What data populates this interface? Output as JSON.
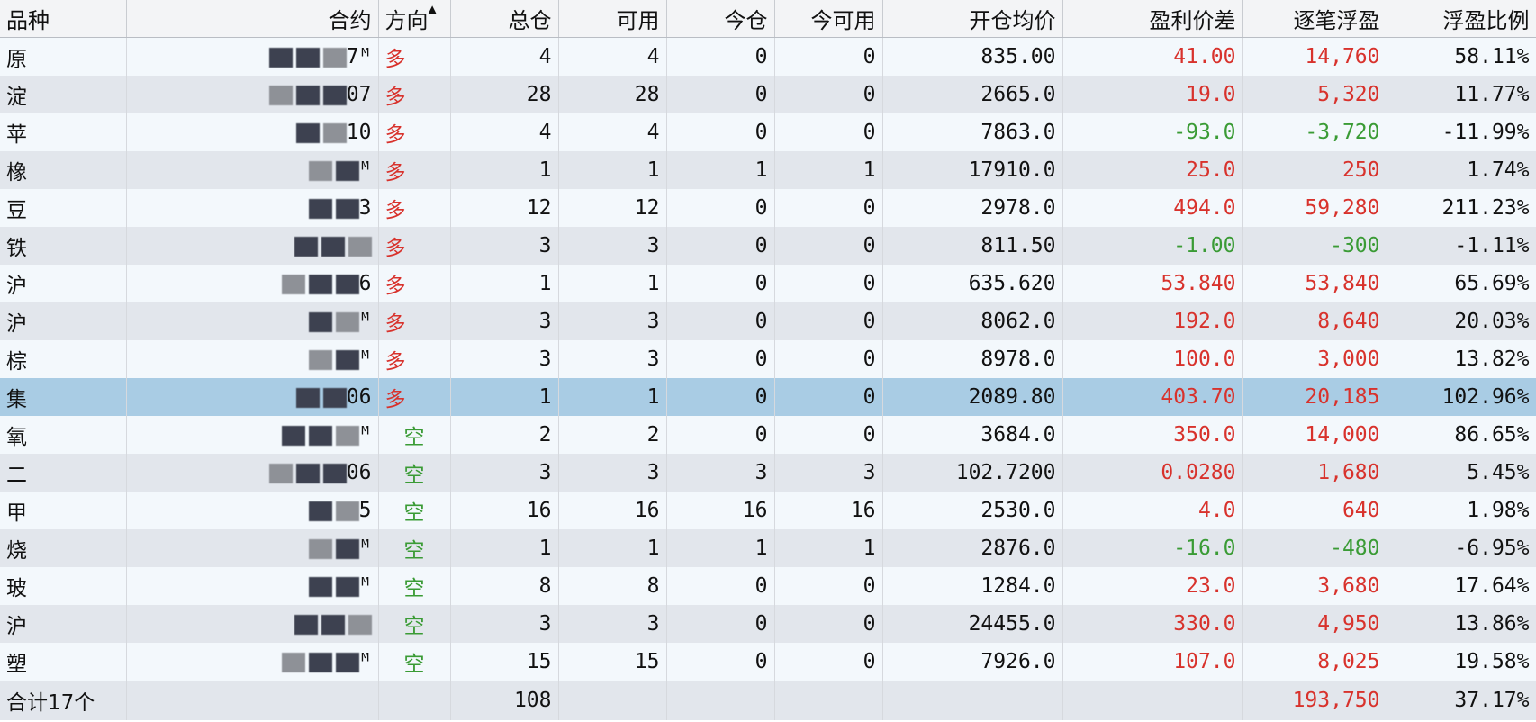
{
  "headers": {
    "variety": "品种",
    "contract": "合约",
    "direction": "方向",
    "total": "总仓",
    "available": "可用",
    "today": "今仓",
    "today_available": "今可用",
    "avg_price": "开仓均价",
    "profit_diff": "盈利价差",
    "float_pl": "逐笔浮盈",
    "float_ratio": "浮盈比例"
  },
  "sort_indicator": "▲",
  "rows": [
    {
      "variety": "原",
      "contract": "7ᴹ",
      "direction": "多",
      "dir_type": "long",
      "total": "4",
      "avail": "4",
      "today": "0",
      "today_avail": "0",
      "avg": "835.00",
      "diff": "41.00",
      "pl": "14,760",
      "ratio": "58.11%",
      "sign": "pos"
    },
    {
      "variety": "淀",
      "contract": "07",
      "direction": "多",
      "dir_type": "long",
      "total": "28",
      "avail": "28",
      "today": "0",
      "today_avail": "0",
      "avg": "2665.0",
      "diff": "19.0",
      "pl": "5,320",
      "ratio": "11.77%",
      "sign": "pos"
    },
    {
      "variety": "苹",
      "contract": "10",
      "direction": "多",
      "dir_type": "long",
      "total": "4",
      "avail": "4",
      "today": "0",
      "today_avail": "0",
      "avg": "7863.0",
      "diff": "-93.0",
      "pl": "-3,720",
      "ratio": "-11.99%",
      "sign": "neg"
    },
    {
      "variety": "橡",
      "contract": "ᴹ",
      "direction": "多",
      "dir_type": "long",
      "total": "1",
      "avail": "1",
      "today": "1",
      "today_avail": "1",
      "avg": "17910.0",
      "diff": "25.0",
      "pl": "250",
      "ratio": "1.74%",
      "sign": "pos"
    },
    {
      "variety": "豆",
      "contract": "3",
      "direction": "多",
      "dir_type": "long",
      "total": "12",
      "avail": "12",
      "today": "0",
      "today_avail": "0",
      "avg": "2978.0",
      "diff": "494.0",
      "pl": "59,280",
      "ratio": "211.23%",
      "sign": "pos"
    },
    {
      "variety": "铁",
      "contract": "",
      "direction": "多",
      "dir_type": "long",
      "total": "3",
      "avail": "3",
      "today": "0",
      "today_avail": "0",
      "avg": "811.50",
      "diff": "-1.00",
      "pl": "-300",
      "ratio": "-1.11%",
      "sign": "neg"
    },
    {
      "variety": "沪",
      "contract": "6",
      "direction": "多",
      "dir_type": "long",
      "total": "1",
      "avail": "1",
      "today": "0",
      "today_avail": "0",
      "avg": "635.620",
      "diff": "53.840",
      "pl": "53,840",
      "ratio": "65.69%",
      "sign": "pos"
    },
    {
      "variety": "沪",
      "contract": "ᴹ",
      "direction": "多",
      "dir_type": "long",
      "total": "3",
      "avail": "3",
      "today": "0",
      "today_avail": "0",
      "avg": "8062.0",
      "diff": "192.0",
      "pl": "8,640",
      "ratio": "20.03%",
      "sign": "pos"
    },
    {
      "variety": "棕",
      "contract": "ᴹ",
      "direction": "多",
      "dir_type": "long",
      "total": "3",
      "avail": "3",
      "today": "0",
      "today_avail": "0",
      "avg": "8978.0",
      "diff": "100.0",
      "pl": "3,000",
      "ratio": "13.82%",
      "sign": "pos"
    },
    {
      "variety": "集",
      "contract": "06",
      "direction": "多",
      "dir_type": "long",
      "total": "1",
      "avail": "1",
      "today": "0",
      "today_avail": "0",
      "avg": "2089.80",
      "diff": "403.70",
      "pl": "20,185",
      "ratio": "102.96%",
      "sign": "pos",
      "selected": true
    },
    {
      "variety": "氧",
      "contract": "ᴹ",
      "direction": "空",
      "dir_type": "short",
      "total": "2",
      "avail": "2",
      "today": "0",
      "today_avail": "0",
      "avg": "3684.0",
      "diff": "350.0",
      "pl": "14,000",
      "ratio": "86.65%",
      "sign": "pos"
    },
    {
      "variety": "二",
      "contract": "06",
      "direction": "空",
      "dir_type": "short",
      "total": "3",
      "avail": "3",
      "today": "3",
      "today_avail": "3",
      "avg": "102.7200",
      "diff": "0.0280",
      "pl": "1,680",
      "ratio": "5.45%",
      "sign": "pos"
    },
    {
      "variety": "甲",
      "contract": "5",
      "direction": "空",
      "dir_type": "short",
      "total": "16",
      "avail": "16",
      "today": "16",
      "today_avail": "16",
      "avg": "2530.0",
      "diff": "4.0",
      "pl": "640",
      "ratio": "1.98%",
      "sign": "pos"
    },
    {
      "variety": "烧",
      "contract": "ᴹ",
      "direction": "空",
      "dir_type": "short",
      "total": "1",
      "avail": "1",
      "today": "1",
      "today_avail": "1",
      "avg": "2876.0",
      "diff": "-16.0",
      "pl": "-480",
      "ratio": "-6.95%",
      "sign": "neg"
    },
    {
      "variety": "玻",
      "contract": "ᴹ",
      "direction": "空",
      "dir_type": "short",
      "total": "8",
      "avail": "8",
      "today": "0",
      "today_avail": "0",
      "avg": "1284.0",
      "diff": "23.0",
      "pl": "3,680",
      "ratio": "17.64%",
      "sign": "pos"
    },
    {
      "variety": "沪",
      "contract": "",
      "direction": "空",
      "dir_type": "short",
      "total": "3",
      "avail": "3",
      "today": "0",
      "today_avail": "0",
      "avg": "24455.0",
      "diff": "330.0",
      "pl": "4,950",
      "ratio": "13.86%",
      "sign": "pos"
    },
    {
      "variety": "塑",
      "contract": "ᴹ",
      "direction": "空",
      "dir_type": "short",
      "total": "15",
      "avail": "15",
      "today": "0",
      "today_avail": "0",
      "avg": "7926.0",
      "diff": "107.0",
      "pl": "8,025",
      "ratio": "19.58%",
      "sign": "pos"
    }
  ],
  "total_row": {
    "label": "合计17个",
    "total": "108",
    "float_pl": "193,750",
    "float_ratio": "37.17%"
  },
  "colors": {
    "profit": "#d8322c",
    "loss": "#3a9b35",
    "selected_row": "#a9cce4"
  }
}
